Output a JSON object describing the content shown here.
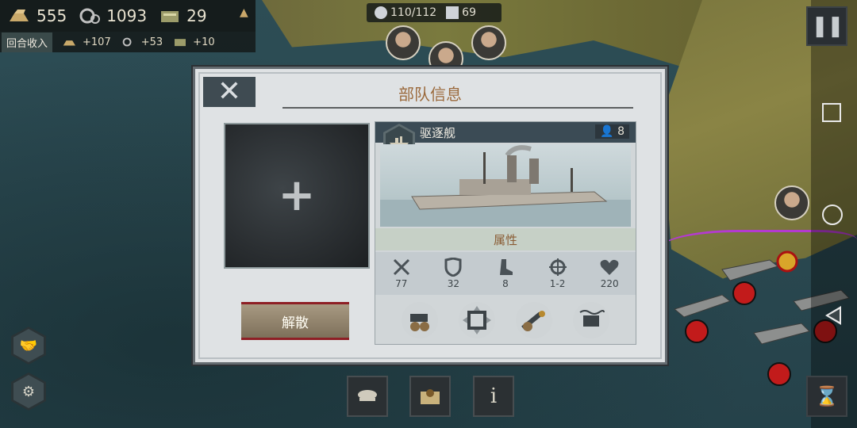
{
  "resources": [
    {
      "icon": "gold-bars-icon",
      "value": "555"
    },
    {
      "icon": "industry-gears-icon",
      "value": "1093"
    },
    {
      "icon": "supplies-icon",
      "value": "29"
    }
  ],
  "income": {
    "label": "回合收入",
    "items": [
      {
        "icon": "gold-bars-icon",
        "value": "+107"
      },
      {
        "icon": "industry-gears-icon",
        "value": "+53"
      },
      {
        "icon": "supplies-icon",
        "value": "+10"
      }
    ]
  },
  "top_status": {
    "population": "110/112",
    "command": "69"
  },
  "dialog": {
    "title": "部队信息",
    "disband_label": "解散",
    "unit": {
      "name": "驱逐舰",
      "count": "8",
      "attributes_label": "属性",
      "stats": [
        {
          "icon": "crossed-swords-icon",
          "value": "77"
        },
        {
          "icon": "shield-icon",
          "value": "32"
        },
        {
          "icon": "boot-icon",
          "value": "8"
        },
        {
          "icon": "crosshair-icon",
          "value": "1-2"
        },
        {
          "icon": "heart-icon",
          "value": "220"
        }
      ],
      "abilities": [
        "cannon-ability-icon",
        "fortify-ability-icon",
        "bombard-ability-icon",
        "naval-ability-icon"
      ]
    }
  },
  "bottom_buttons": [
    "officer-cap-icon",
    "map-pin-icon",
    "info-icon"
  ],
  "colors": {
    "accent_title": "#9b6a3d",
    "dialog_bg": "#dfe2e4",
    "card_header": "#3b4b55",
    "disband_stripe": "#8e1f25"
  }
}
